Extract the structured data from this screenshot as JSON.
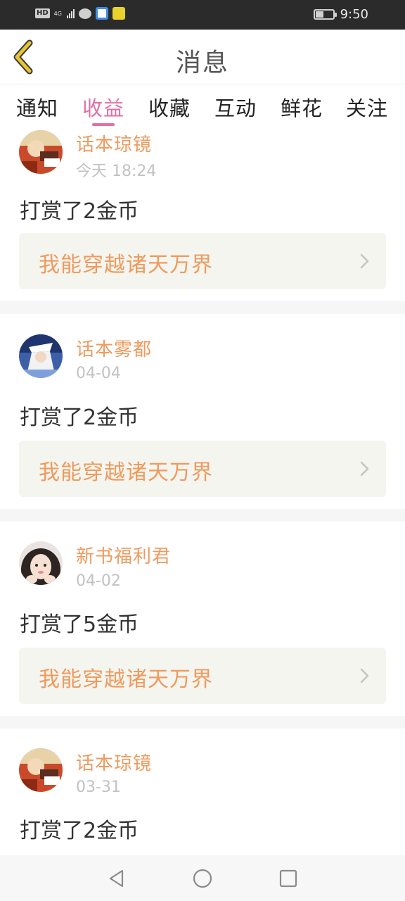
{
  "status_bar": {
    "hd_badge": "HD",
    "network": "4G",
    "time": "9:50",
    "battery_level": 0.45,
    "icons": [
      "wechat-icon",
      "app-icon",
      "app-icon"
    ]
  },
  "header": {
    "title": "消息",
    "back_icon": "chevron-left-icon"
  },
  "tabs": [
    {
      "label": "通知",
      "active": false
    },
    {
      "label": "收益",
      "active": true
    },
    {
      "label": "收藏",
      "active": false
    },
    {
      "label": "互动",
      "active": false
    },
    {
      "label": "鲜花",
      "active": false
    },
    {
      "label": "关注",
      "active": false
    }
  ],
  "messages": [
    {
      "username": "话本琼镜",
      "time": "今天 18:24",
      "text": "打赏了2金币",
      "book": "我能穿越诸天万界"
    },
    {
      "username": "话本雾都",
      "time": "04-04",
      "text": "打赏了2金币",
      "book": "我能穿越诸天万界"
    },
    {
      "username": "新书福利君",
      "time": "04-02",
      "text": "打赏了5金币",
      "book": "我能穿越诸天万界"
    },
    {
      "username": "话本琼镜",
      "time": "03-31",
      "text": "打赏了2金币",
      "book": ""
    }
  ],
  "colors": {
    "accent": "#e26fa5",
    "username": "#ef9a5e",
    "back_arrow": "#e8c431",
    "status_bar_bg": "#2b2b2b"
  },
  "nav_bar": [
    "back-triangle-icon",
    "home-circle-icon",
    "recents-square-icon"
  ]
}
